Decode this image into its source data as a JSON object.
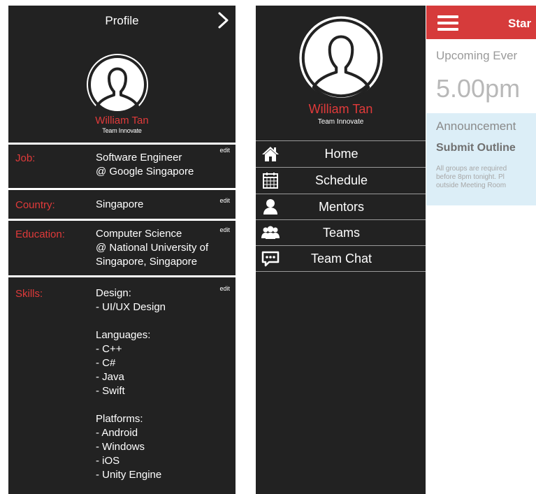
{
  "profile": {
    "title": "Profile",
    "name": "William Tan",
    "team": "Team Innovate",
    "rows": [
      {
        "label": "Job:",
        "value": "Software Engineer\n@ Google Singapore",
        "edit": "edit"
      },
      {
        "label": "Country:",
        "value": "Singapore",
        "edit": "edit"
      },
      {
        "label": "Education:",
        "value": "Computer Science\n@ National University of\nSingapore, Singapore",
        "edit": "edit"
      },
      {
        "label": "Skills:",
        "value": "Design:\n- UI/UX Design\n\nLanguages:\n- C++\n- C#\n- Java\n- Swift\n\nPlatforms:\n- Android\n- Windows\n- iOS\n- Unity Engine",
        "edit": "edit"
      }
    ]
  },
  "menu": {
    "name": "William Tan",
    "team": "Team Innovate",
    "items": [
      {
        "label": "Home",
        "icon": "home-icon"
      },
      {
        "label": "Schedule",
        "icon": "calendar-icon"
      },
      {
        "label": "Mentors",
        "icon": "person-icon"
      },
      {
        "label": "Teams",
        "icon": "group-icon"
      },
      {
        "label": "Team Chat",
        "icon": "chat-icon"
      }
    ]
  },
  "content": {
    "header_title": "Star",
    "upcoming_label": "Upcoming Ever",
    "time": "5.00pm",
    "announcement_label": "Announcement",
    "announcement_title": "Submit Outline",
    "announcement_body": "All groups are required\nbefore 8pm tonight. Pl\noutside Meeting Room"
  },
  "colors": {
    "panel_bg": "#222222",
    "accent_red": "#e03a3a",
    "header_red": "#d63b3b",
    "announcement_bg": "#dceef7"
  }
}
